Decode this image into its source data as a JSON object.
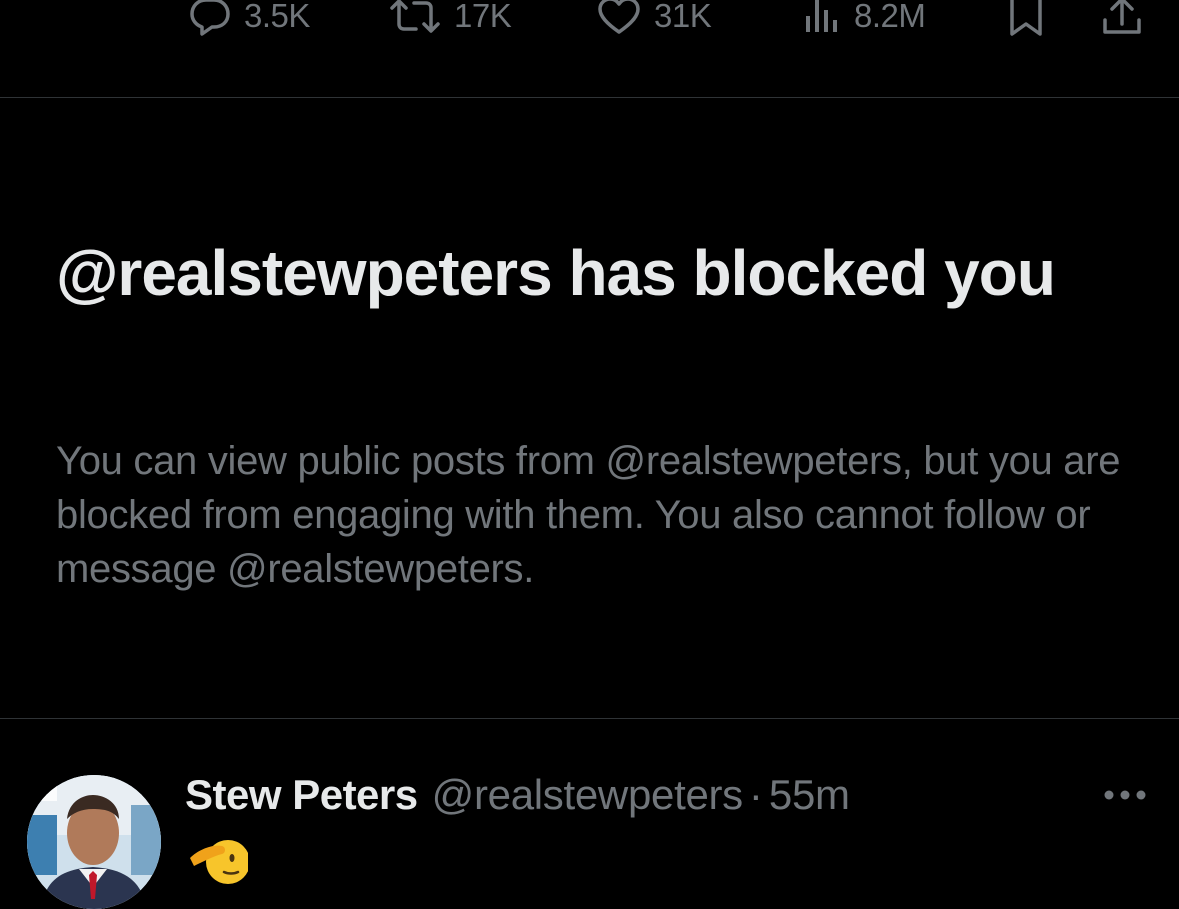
{
  "actions": {
    "replies": "3.5K",
    "reposts": "17K",
    "likes": "31K",
    "views": "8.2M",
    "icons": [
      "reply-icon",
      "repost-icon",
      "like-icon",
      "views-icon",
      "bookmark-icon",
      "share-icon"
    ]
  },
  "blocked_notice": {
    "title": "@realstewpeters has blocked you",
    "description": "You can view public posts from @realstewpeters, but you are blocked from engaging with them. You also cannot follow or message @realstewpeters."
  },
  "next_tweet": {
    "author_name": "Stew Peters",
    "handle": "@realstewpeters",
    "separator": "·",
    "time": "55m",
    "emoji": "saluting-face",
    "more_icon": "more-options-icon"
  },
  "colors": {
    "background": "#000000",
    "primary_text": "#e7e9ea",
    "secondary_text": "#71767b",
    "divider": "#2f3336"
  }
}
